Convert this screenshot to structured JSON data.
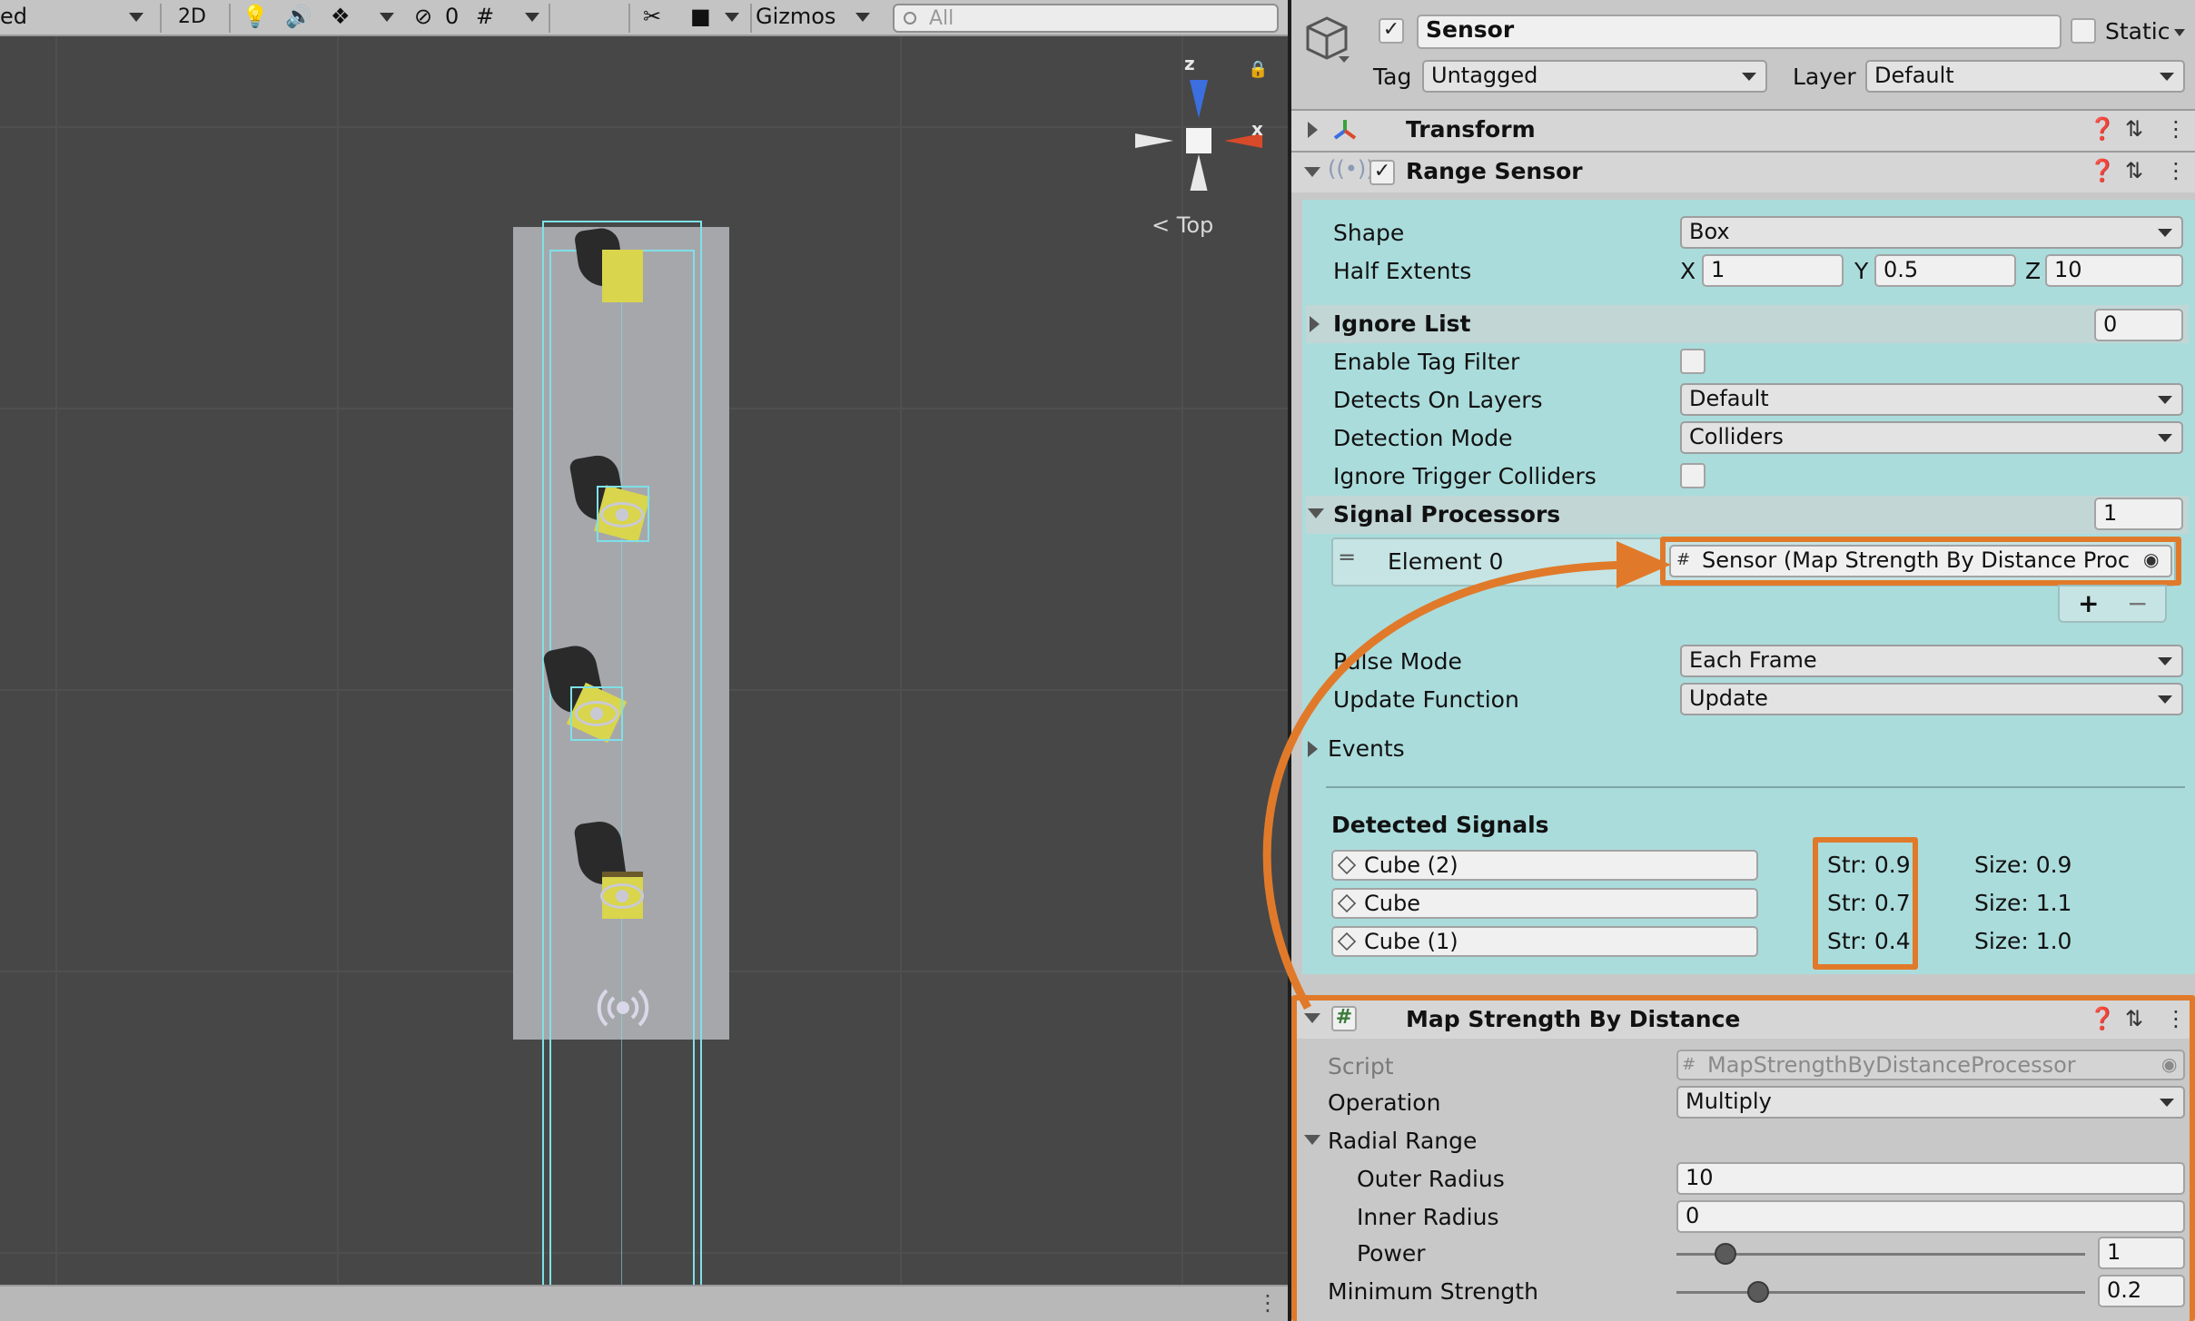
{
  "scene_toolbar": {
    "draw_mode_label": "ed",
    "mode_2d": "2D",
    "hidden_count": "0",
    "gizmos_label": "Gizmos",
    "search_placeholder": "All"
  },
  "scene": {
    "orientation_label": "Top",
    "gizmo_z": "z",
    "gizmo_x": "x"
  },
  "inspector": {
    "object_name": "Sensor",
    "static_label": "Static",
    "tag_label": "Tag",
    "tag_value": "Untagged",
    "layer_label": "Layer",
    "layer_value": "Default",
    "components": {
      "transform": "Transform",
      "range_sensor": "Range Sensor",
      "map_strength": "Map Strength By Distance"
    },
    "range_sensor": {
      "shape_label": "Shape",
      "shape_value": "Box",
      "half_extents_label": "Half Extents",
      "x_label": "X",
      "x_value": "1",
      "y_label": "Y",
      "y_value": "0.5",
      "z_label": "Z",
      "z_value": "10",
      "ignore_list_label": "Ignore List",
      "ignore_list_count": "0",
      "enable_tag_filter_label": "Enable Tag Filter",
      "detects_on_layers_label": "Detects On Layers",
      "detects_on_layers_value": "Default",
      "detection_mode_label": "Detection Mode",
      "detection_mode_value": "Colliders",
      "ignore_trigger_label": "Ignore Trigger Colliders",
      "signal_processors_label": "Signal Processors",
      "signal_processors_count": "1",
      "element0_label": "Element 0",
      "element0_value": "Sensor (Map Strength By Distance Proc",
      "add_label": "+",
      "remove_label": "−",
      "pulse_mode_label": "Pulse Mode",
      "pulse_mode_value": "Each Frame",
      "update_function_label": "Update Function",
      "update_function_value": "Update",
      "events_label": "Events",
      "detected_signals_label": "Detected Signals",
      "signals": [
        {
          "name": "Cube (2)",
          "strength": "Str: 0.9",
          "size": "Size: 0.9"
        },
        {
          "name": "Cube",
          "strength": "Str: 0.7",
          "size": "Size: 1.1"
        },
        {
          "name": "Cube (1)",
          "strength": "Str: 0.4",
          "size": "Size: 1.0"
        }
      ]
    },
    "map_strength": {
      "script_label": "Script",
      "script_value": "MapStrengthByDistanceProcessor",
      "operation_label": "Operation",
      "operation_value": "Multiply",
      "radial_range_label": "Radial Range",
      "outer_radius_label": "Outer Radius",
      "outer_radius_value": "10",
      "inner_radius_label": "Inner Radius",
      "inner_radius_value": "0",
      "power_label": "Power",
      "power_value": "1",
      "power_slider_fraction": 0.12,
      "min_strength_label": "Minimum Strength",
      "min_strength_value": "0.2",
      "min_strength_slider_fraction": 0.2
    }
  },
  "colors": {
    "highlight": "#e07a2a",
    "sensor_tint": "#abdcdc",
    "scene_bg": "#474747"
  }
}
